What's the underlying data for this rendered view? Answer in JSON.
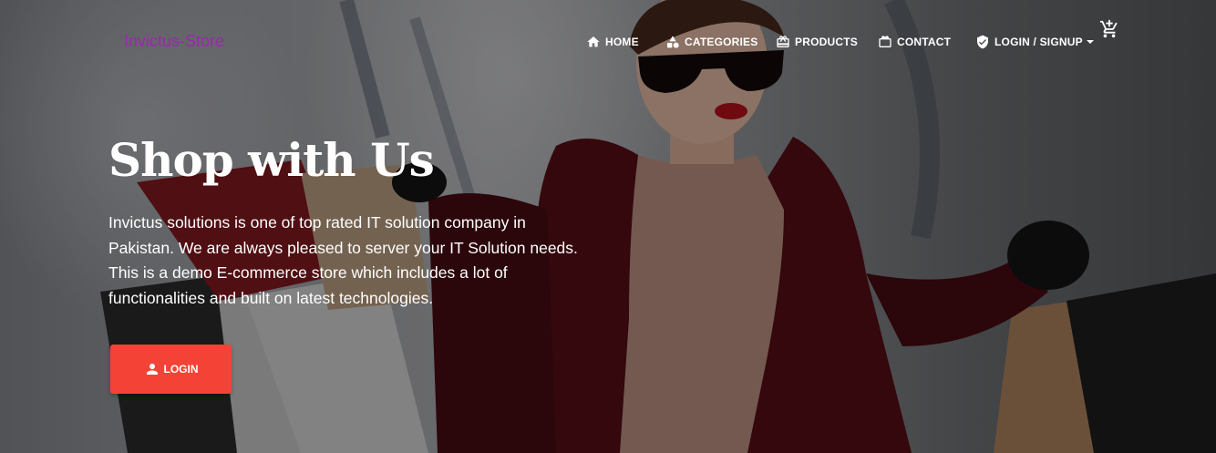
{
  "brand": {
    "name": "Invictus-Store",
    "color": "#9c27b0"
  },
  "nav": {
    "items": [
      {
        "label": "HOME",
        "icon": "home-icon"
      },
      {
        "label": "CATEGORIES",
        "icon": "category-icon"
      },
      {
        "label": "PRODUCTS",
        "icon": "redeem-icon"
      },
      {
        "label": "CONTACT",
        "icon": "card-giftcard-icon"
      },
      {
        "label": "LOGIN / SIGNUP",
        "icon": "verified-user-icon",
        "dropdown": true
      }
    ],
    "cart_icon": "add-shopping-cart-icon"
  },
  "hero": {
    "title": "Shop with Us",
    "lines": [
      "Invictus solutions is one of top rated IT solution company in",
      "Pakistan. We are always pleased to server your IT Solution needs.",
      "This is a demo E-commerce store which includes a lot of",
      "functionalities and built on latest technologies."
    ],
    "button": {
      "label": "LOGIN",
      "icon": "person-icon",
      "color": "#f44336"
    }
  }
}
